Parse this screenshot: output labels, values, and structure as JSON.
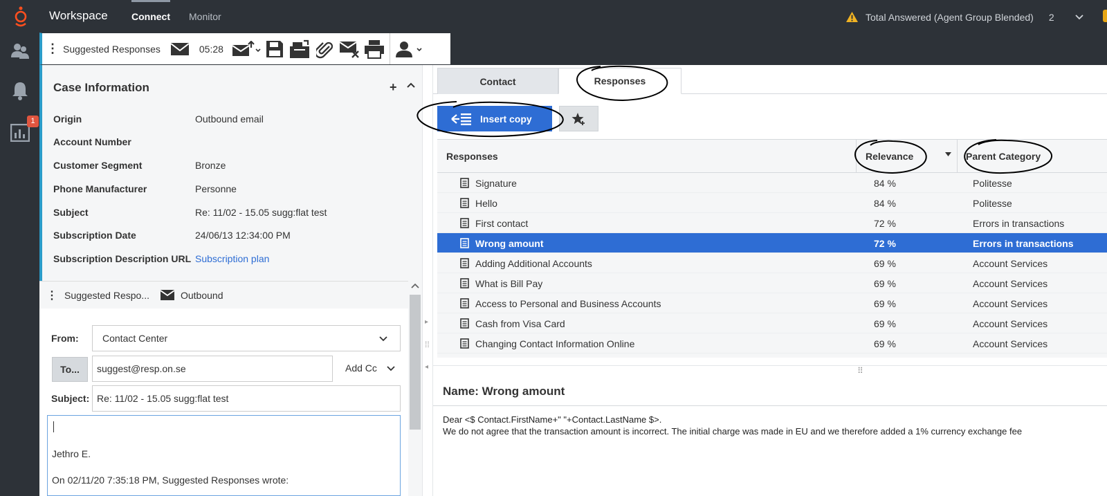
{
  "topbar": {
    "app_title": "Workspace",
    "tabs": [
      {
        "label": "Connect",
        "active": true
      },
      {
        "label": "Monitor",
        "active": false
      }
    ],
    "alert_text": "Total Answered (Agent Group Blended)",
    "alert_count": "2",
    "warning_color": "#f0b323"
  },
  "rail": {
    "badge_count": "1"
  },
  "toolbar": {
    "title": "Suggested Responses",
    "timer": "05:28"
  },
  "case": {
    "title": "Case Information",
    "fields": [
      {
        "label": "Origin",
        "value": "Outbound email"
      },
      {
        "label": "Account Number",
        "value": ""
      },
      {
        "label": "Customer Segment",
        "value": "Bronze"
      },
      {
        "label": "Phone Manufacturer",
        "value": "Personne"
      },
      {
        "label": "Subject",
        "value": "Re: 11/02 - 15.05 sugg:flat test"
      },
      {
        "label": "Subscription Date",
        "value": "24/06/13 12:34:00 PM"
      },
      {
        "label": "Subscription Description URL",
        "value": "Subscription plan"
      }
    ]
  },
  "email": {
    "header_title": "Suggested Respo...",
    "header_type": "Outbound",
    "from_label": "From:",
    "from_value": "Contact Center",
    "to_button": "To...",
    "to_value": "suggest@resp.on.se",
    "add_cc": "Add Cc",
    "subject_label": "Subject:",
    "subject_value": "Re: 11/02 - 15.05 sugg:flat test",
    "body_signature": "Jethro E.",
    "body_quote": "On 02/11/20 7:35:18 PM, Suggested Responses wrote:"
  },
  "right": {
    "tabs": [
      {
        "label": "Contact",
        "active": false
      },
      {
        "label": "Responses",
        "active": true
      }
    ],
    "insert_button": "Insert copy",
    "grid": {
      "columns": [
        "Responses",
        "Relevance",
        "Parent Category"
      ],
      "rows": [
        {
          "name": "Signature",
          "relevance": "84 %",
          "category": "Politesse",
          "selected": false
        },
        {
          "name": "Hello",
          "relevance": "84 %",
          "category": "Politesse",
          "selected": false
        },
        {
          "name": "First contact",
          "relevance": "72 %",
          "category": "Errors in transactions",
          "selected": false
        },
        {
          "name": "Wrong amount",
          "relevance": "72 %",
          "category": "Errors in transactions",
          "selected": true
        },
        {
          "name": "Adding Additional Accounts",
          "relevance": "69 %",
          "category": "Account Services",
          "selected": false
        },
        {
          "name": "What is Bill Pay",
          "relevance": "69 %",
          "category": "Account Services",
          "selected": false
        },
        {
          "name": "Access to Personal and Business Accounts",
          "relevance": "69 %",
          "category": "Account Services",
          "selected": false
        },
        {
          "name": "Cash from Visa Card",
          "relevance": "69 %",
          "category": "Account Services",
          "selected": false
        },
        {
          "name": "Changing Contact Information Online",
          "relevance": "69 %",
          "category": "Account Services",
          "selected": false
        }
      ]
    },
    "preview": {
      "title": "Name: Wrong amount",
      "line1": "Dear <$ Contact.FirstName+\" \"+Contact.LastName $>.",
      "line2": "We do not agree that the transaction amount is incorrect. The initial charge was made in EU and we therefore added a 1% currency exchange fee"
    }
  },
  "colors": {
    "accent": "#2e6dd4",
    "dark_bg": "#2d3238",
    "teal_bar": "#2b9cc9",
    "brand_orange": "#ff4f1f"
  }
}
